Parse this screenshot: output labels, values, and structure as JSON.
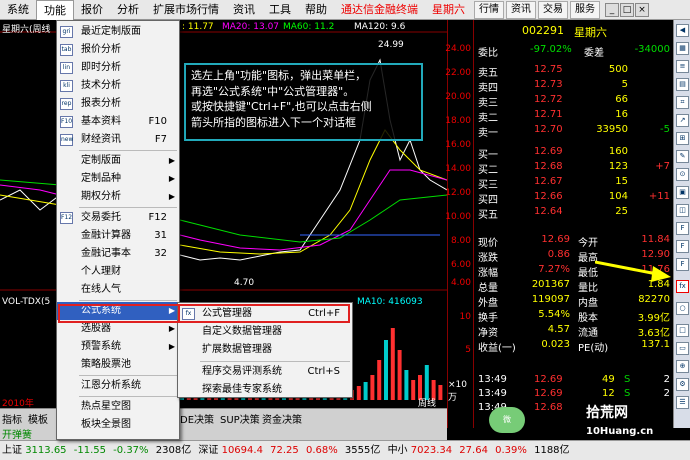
{
  "menubar": {
    "items": [
      "系统",
      "功能",
      "报价",
      "分析",
      "扩展市场行情",
      "资讯",
      "工具",
      "帮助"
    ],
    "active_index": 1,
    "title": "通达信金融终端",
    "day": "星期六",
    "buttons": [
      "行情",
      "资讯",
      "交易",
      "服务"
    ]
  },
  "chart": {
    "title_left": "星期六(周线",
    "ma20": "MA20: 13.07",
    "ma60": "MA60: 11.2",
    "ma120": "MA120: 9.6",
    "ma_prefix": ": 11.77",
    "high": "24.99",
    "low": "4.70",
    "vol_label": "VOL-TDX(5",
    "vol_ma10": "MA10: 416093",
    "year_label": "2010年",
    "period_label": "周线",
    "axis_labels": [
      "24.00",
      "22.00",
      "20.00",
      "18.00",
      "16.00",
      "14.00",
      "12.00",
      "10.00",
      "8.00",
      "6.00",
      "4.00"
    ],
    "vol_axis_labels": [
      "10",
      "5",
      "×10万"
    ]
  },
  "callout": {
    "line1": "选左上角\"功能\"图标，弹出菜单栏，",
    "line2": "再选\"公式系统\"中\"公式管理器\"。",
    "line3": "或按快捷键\"Ctrl+F\",也可以点击右侧",
    "line4": "箭头所指的图标进入下一个对话框"
  },
  "menu1": {
    "items": [
      {
        "label": "最近定制版面",
        "shortcut": "",
        "arrow": false,
        "icon": "grid"
      },
      {
        "label": "报价分析",
        "shortcut": "",
        "arrow": false,
        "icon": "table"
      },
      {
        "label": "即时分析",
        "shortcut": "",
        "arrow": false,
        "icon": "line"
      },
      {
        "label": "技术分析",
        "shortcut": "",
        "arrow": false,
        "icon": "kline"
      },
      {
        "label": "报表分析",
        "shortcut": "",
        "arrow": false,
        "icon": "report"
      },
      {
        "label": "基本资料",
        "shortcut": "F10",
        "arrow": false,
        "icon": "F10"
      },
      {
        "label": "财经资讯",
        "shortcut": "F7",
        "arrow": false,
        "icon": "news"
      },
      {
        "label": "定制版面",
        "shortcut": "",
        "arrow": true,
        "icon": ""
      },
      {
        "label": "定制品种",
        "shortcut": "",
        "arrow": true,
        "icon": ""
      },
      {
        "label": "期权分析",
        "shortcut": "",
        "arrow": true,
        "icon": ""
      },
      {
        "label": "交易委托",
        "shortcut": "F12",
        "arrow": false,
        "icon": "F12"
      },
      {
        "label": "金融计算器",
        "shortcut": "31",
        "arrow": false,
        "icon": ""
      },
      {
        "label": "金融记事本",
        "shortcut": "32",
        "arrow": false,
        "icon": ""
      },
      {
        "label": "个人理财",
        "shortcut": "",
        "arrow": false,
        "icon": ""
      },
      {
        "label": "在线人气",
        "shortcut": "",
        "arrow": false,
        "icon": ""
      },
      {
        "label": "公式系统",
        "shortcut": "",
        "arrow": true,
        "icon": ""
      },
      {
        "label": "选股器",
        "shortcut": "",
        "arrow": true,
        "icon": ""
      },
      {
        "label": "预警系统",
        "shortcut": "",
        "arrow": true,
        "icon": ""
      },
      {
        "label": "策略股票池",
        "shortcut": "",
        "arrow": false,
        "icon": ""
      },
      {
        "label": "江恩分析系统",
        "shortcut": "",
        "arrow": false,
        "icon": ""
      },
      {
        "label": "热点星空图",
        "shortcut": "",
        "arrow": false,
        "icon": ""
      },
      {
        "label": "板块全景图",
        "shortcut": "",
        "arrow": false,
        "icon": ""
      }
    ]
  },
  "menu2": {
    "items": [
      {
        "label": "公式管理器",
        "shortcut": "Ctrl+F",
        "icon": "fx"
      },
      {
        "label": "自定义数据管理器",
        "shortcut": "",
        "icon": ""
      },
      {
        "label": "扩展数据管理器",
        "shortcut": "",
        "icon": ""
      },
      {
        "label": "程序交易评测系统",
        "shortcut": "Ctrl+S",
        "icon": ""
      },
      {
        "label": "探索最佳专家系统",
        "shortcut": "",
        "icon": ""
      }
    ]
  },
  "quote": {
    "code": "002291",
    "name": "星期六",
    "weibi_label": "委比",
    "weibi": "-97.02%",
    "weicha_label": "委差",
    "weicha": "-34000",
    "asks": [
      {
        "label": "卖五",
        "price": "12.75",
        "vol": "500",
        "chg": ""
      },
      {
        "label": "卖四",
        "price": "12.73",
        "vol": "5",
        "chg": ""
      },
      {
        "label": "卖三",
        "price": "12.72",
        "vol": "66",
        "chg": ""
      },
      {
        "label": "卖二",
        "price": "12.71",
        "vol": "16",
        "chg": ""
      },
      {
        "label": "卖一",
        "price": "12.70",
        "vol": "33950",
        "chg": "-5"
      }
    ],
    "bids": [
      {
        "label": "买一",
        "price": "12.69",
        "vol": "160",
        "chg": ""
      },
      {
        "label": "买二",
        "price": "12.68",
        "vol": "123",
        "chg": "+7"
      },
      {
        "label": "买三",
        "price": "12.67",
        "vol": "15",
        "chg": ""
      },
      {
        "label": "买四",
        "price": "12.66",
        "vol": "104",
        "chg": "+11"
      },
      {
        "label": "买五",
        "price": "12.64",
        "vol": "25",
        "chg": ""
      }
    ],
    "stats": [
      {
        "l1": "现价",
        "v1": "12.69",
        "l2": "今开",
        "v2": "11.84"
      },
      {
        "l1": "涨跌",
        "v1": "0.86",
        "l2": "最高",
        "v2": "12.90"
      },
      {
        "l1": "涨幅",
        "v1": "7.27%",
        "l2": "最低",
        "v2": "11.76"
      },
      {
        "l1": "总量",
        "v1": "201367",
        "l2": "量比",
        "v2": "1.84"
      },
      {
        "l1": "外盘",
        "v1": "119097",
        "l2": "内盘",
        "v2": "82270"
      },
      {
        "l1": "换手",
        "v1": "5.54%",
        "l2": "股本",
        "v2": "3.99亿"
      },
      {
        "l1": "净资",
        "v1": "4.57",
        "l2": "流通",
        "v2": "3.63亿"
      },
      {
        "l1": "收益(一)",
        "v1": "0.023",
        "l2": "PE(动)",
        "v2": "137.1"
      }
    ],
    "ticks": [
      {
        "time": "13:49",
        "price": "12.69",
        "vol": "49",
        "flag": "S",
        "n": "2"
      },
      {
        "time": "13:49",
        "price": "12.69",
        "vol": "12",
        "flag": "S",
        "n": "2"
      },
      {
        "time": "13:49",
        "price": "12.68",
        "vol": "",
        "flag": "",
        "n": ""
      }
    ]
  },
  "tabs": {
    "row1": [
      "指标",
      "模板"
    ],
    "row1b": [
      "DE决策",
      "SUP决策",
      "资金决策"
    ],
    "row2": "开弹簧"
  },
  "statusbar": {
    "sh_label": "上证",
    "sh": "3113.65",
    "sh_chg": "-11.55",
    "sh_pct": "-0.37%",
    "sh_amt": "2308亿",
    "sz_label": "深证",
    "sz": "10694.4",
    "sz_chg": "72.25",
    "sz_pct": "0.68%",
    "sz_amt": "3555亿",
    "zx_label": "中小",
    "zx": "7023.34",
    "zx_chg": "27.64",
    "zx_pct": "0.39%",
    "zx_amt": "1188亿"
  },
  "watermark": "拾荒网",
  "watermark_sub": "10Huang.cn",
  "wechat": "微",
  "colors": {
    "up": "#ff3030",
    "down": "#00d000",
    "neutral": "#ffffff",
    "yellow": "#ffff00",
    "cyan": "#00ffff",
    "accent": "#e02020"
  }
}
